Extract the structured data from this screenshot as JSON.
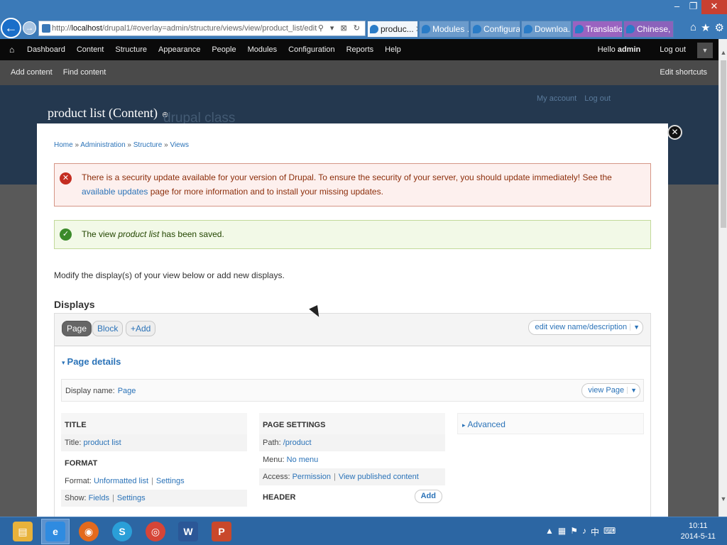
{
  "browser": {
    "url_prefix": "http://",
    "url_host": "localhost",
    "url_path": "/drupal1/#overlay=admin/structure/views/view/product_list/edit",
    "addr_controls": "⚲ ▾ ⊠ ↻",
    "tabs": [
      {
        "label": "produc...",
        "close": "✕"
      },
      {
        "label": "Modules ..."
      },
      {
        "label": "Configura..."
      },
      {
        "label": "Downloa..."
      },
      {
        "label": "Translatio..."
      },
      {
        "label": "Chinese, ..."
      }
    ],
    "window_buttons": [
      "–",
      "❐",
      "✕"
    ],
    "icons": [
      "⌂",
      "★",
      "⚙"
    ]
  },
  "toolbar": {
    "home_icon": "⌂",
    "items": [
      "Dashboard",
      "Content",
      "Structure",
      "Appearance",
      "People",
      "Modules",
      "Configuration",
      "Reports",
      "Help"
    ],
    "hello": "Hello",
    "user": "admin",
    "logout": "Log out",
    "drawer": "▼"
  },
  "shortcuts": {
    "items": [
      "Add content",
      "Find content"
    ],
    "edit": "Edit shortcuts"
  },
  "site": {
    "page_title": "product list (Content)",
    "site_name": "drupal class",
    "secondary": [
      "My account",
      "Log out"
    ]
  },
  "overlay": {
    "close": "✕",
    "breadcrumb": [
      "Home",
      "Administration",
      "Structure",
      "Views"
    ],
    "breadcrumb_sep": "»",
    "error": {
      "icon": "✕",
      "text_before": "There is a security update available for your version of Drupal. To ensure the security of your server, you should update immediately! See the ",
      "link": "available updates",
      "text_after": " page for more information and to install your missing updates."
    },
    "status": {
      "icon": "✓",
      "before": "The view ",
      "name": "product list",
      "after": " has been saved."
    },
    "intro": "Modify the display(s) of your view below or add new displays.",
    "displays_heading": "Displays",
    "display_tabs": [
      "Page",
      "Block",
      "+Add"
    ],
    "edit_name": "edit view name/description",
    "dropdown_icon": "▼",
    "page_details": "Page details",
    "display_name_label": "Display name:",
    "display_name_value": "Page",
    "view_page": "view Page",
    "title_section": {
      "heading": "TITLE",
      "label": "Title:",
      "value": "product list"
    },
    "format_section": {
      "heading": "FORMAT",
      "format_label": "Format:",
      "format_value": "Unformatted list",
      "format_settings": "Settings",
      "show_label": "Show:",
      "show_value": "Fields",
      "show_settings": "Settings"
    },
    "page_settings": {
      "heading": "PAGE SETTINGS",
      "path_label": "Path:",
      "path_value": "/product",
      "menu_label": "Menu:",
      "menu_value": "No menu",
      "access_label": "Access:",
      "access_value": "Permission",
      "access_extra": "View published content"
    },
    "header_section": {
      "heading": "HEADER",
      "add": "Add"
    },
    "advanced": "Advanced"
  },
  "taskbar": {
    "apps": [
      "file-explorer-icon",
      "internet-explorer-icon",
      "firefox-icon",
      "skype-icon",
      "chrome-icon",
      "word-icon",
      "powerpoint-icon"
    ],
    "time": "10:11",
    "date": "2014-5-11"
  }
}
